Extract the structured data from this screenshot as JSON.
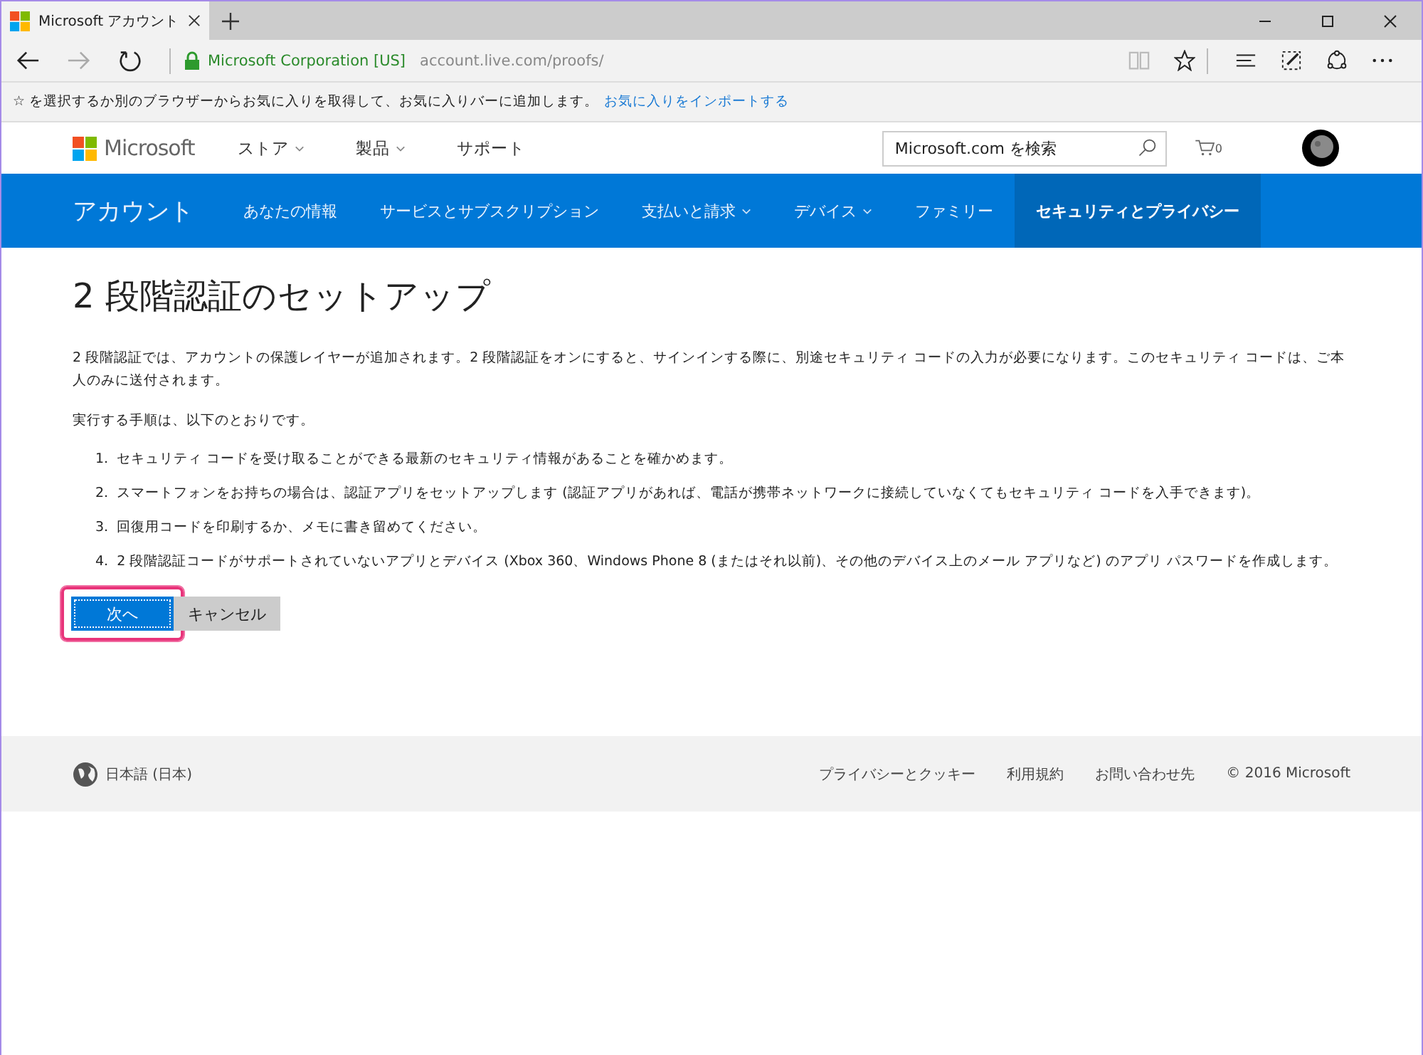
{
  "browser": {
    "tab_title": "Microsoft アカウント",
    "identity": "Microsoft Corporation [US]",
    "url": "account.live.com/proofs/",
    "favorites_hint": "☆ を選択するか別のブラウザーからお気に入りを取得して、お気に入りバーに追加します。",
    "favorites_link": "お気に入りをインポートする"
  },
  "header": {
    "logo": "Microsoft",
    "menu": [
      {
        "label": "ストア",
        "dropdown": true
      },
      {
        "label": "製品",
        "dropdown": true
      },
      {
        "label": "サポート",
        "dropdown": false
      }
    ],
    "search": {
      "placeholder": "Microsoft.com を検索"
    },
    "cart_count": "0"
  },
  "account_nav": {
    "title": "アカウント",
    "tabs": [
      {
        "label": "あなたの情報",
        "dropdown": false,
        "selected": false
      },
      {
        "label": "サービスとサブスクリプション",
        "dropdown": false,
        "selected": false
      },
      {
        "label": "支払いと請求",
        "dropdown": true,
        "selected": false
      },
      {
        "label": "デバイス",
        "dropdown": true,
        "selected": false
      },
      {
        "label": "ファミリー",
        "dropdown": false,
        "selected": false
      },
      {
        "label": "セキュリティとプライバシー",
        "dropdown": false,
        "selected": true
      }
    ]
  },
  "content": {
    "heading": "2 段階認証のセットアップ",
    "intro": "2 段階認証では、アカウントの保護レイヤーが追加されます。2 段階認証をオンにすると、サインインする際に、別途セキュリティ コードの入力が必要になります。このセキュリティ コードは、ご本人のみに送付されます。",
    "steps_intro": "実行する手順は、以下のとおりです。",
    "steps": [
      {
        "number": "1.",
        "text": "セキュリティ コードを受け取ることができる最新のセキュリティ情報があることを確かめます。"
      },
      {
        "number": "2.",
        "text": "スマートフォンをお持ちの場合は、認証アプリをセットアップします (認証アプリがあれば、電話が携帯ネットワークに接続していなくてもセキュリティ コードを入手できます)。"
      },
      {
        "number": "3.",
        "text": "回復用コードを印刷するか、メモに書き留めてください。"
      },
      {
        "number": "4.",
        "text": "2 段階認証コードがサポートされていないアプリとデバイス (Xbox 360、Windows Phone 8 (またはそれ以前)、その他のデバイス上のメール アプリなど) のアプリ パスワードを作成します。"
      }
    ],
    "buttons": [
      {
        "label": "次へ",
        "kind": "primary",
        "highlighted": true
      },
      {
        "label": "キャンセル",
        "kind": "secondary",
        "highlighted": false
      }
    ]
  },
  "footer": {
    "language": "日本語 (日本)",
    "links": [
      "プライバシーとクッキー",
      "利用規約",
      "お問い合わせ先"
    ],
    "copyright": "© 2016 Microsoft"
  }
}
